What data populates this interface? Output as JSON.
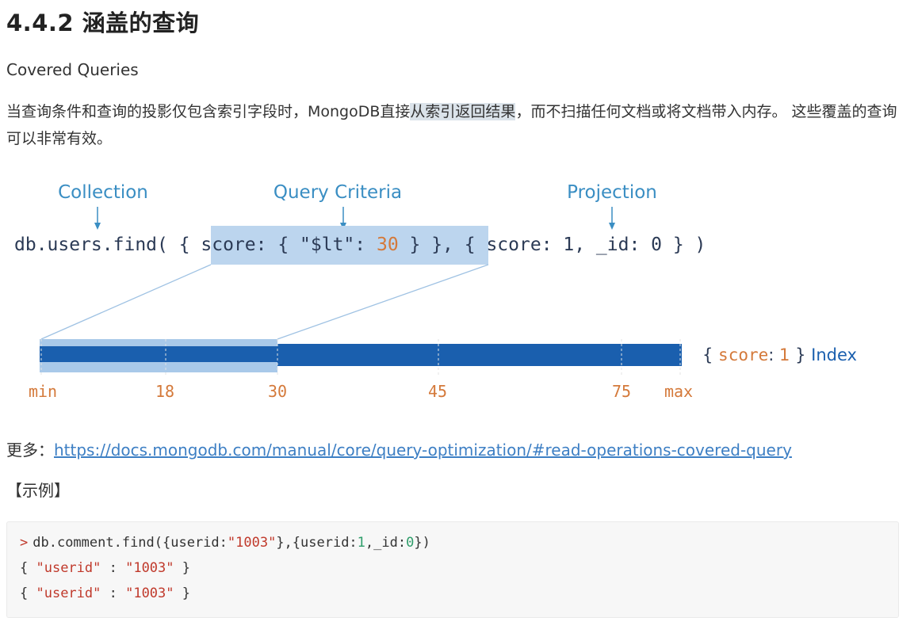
{
  "heading": "4.4.2 涵盖的查询",
  "subtitle": "Covered Queries",
  "paragraph": {
    "before": "当查询条件和查询的投影仅包含索引字段时，MongoDB直接",
    "highlight": "从索引返回结果",
    "after": "，而不扫描任何文档或将文档带入内存。 这些覆盖的查询可以非常有效。"
  },
  "diagram": {
    "labels": {
      "collection": "Collection",
      "criteria": "Query Criteria",
      "projection": "Projection"
    },
    "query": {
      "prefix": "db.users.find( { ",
      "criteria_key": "score: { \"$lt\": ",
      "criteria_value": "30",
      "criteria_suffix": " } },",
      "projection": " { score: 1, _id: 0 } )"
    },
    "index_label": {
      "open": "{ ",
      "field": "score",
      "colon": ": ",
      "value": "1",
      "close": " } ",
      "word": "Index"
    },
    "ticks": [
      "min",
      "18",
      "30",
      "45",
      "75",
      "max"
    ],
    "colors": {
      "label_blue": "#3a8ec3",
      "bar_dark": "#1a5fae",
      "bar_light": "#a9c9e9",
      "tick_orange": "#d4793a",
      "code_text": "#2b3a55"
    }
  },
  "more": {
    "label": "更多：",
    "url": "https://docs.mongodb.com/manual/core/query-optimization/#read-operations-covered-query"
  },
  "example_label": "【示例】",
  "code": {
    "prompt": ">",
    "command": {
      "pre": "db.comment.find({userid:",
      "str": "\"1003\"",
      "mid": "},{userid:",
      "n1": "1",
      "mid2": ",_id:",
      "n2": "0",
      "end": "})"
    },
    "results": [
      {
        "open": "{ ",
        "key": "\"userid\"",
        "sep": " : ",
        "val": "\"1003\"",
        "close": " }"
      },
      {
        "open": "{ ",
        "key": "\"userid\"",
        "sep": " : ",
        "val": "\"1003\"",
        "close": " }"
      }
    ]
  }
}
